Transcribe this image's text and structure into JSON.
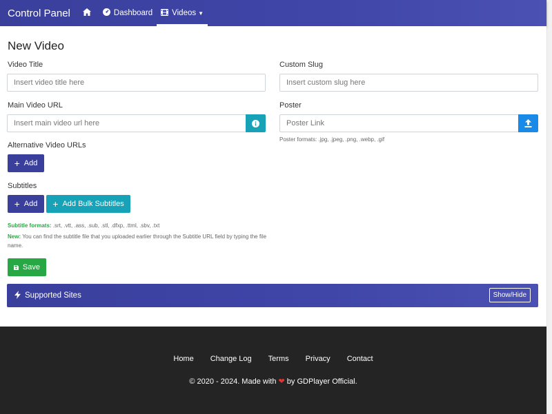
{
  "navbar": {
    "brand": "Control Panel",
    "items": [
      {
        "label": "",
        "icon": "home-icon"
      },
      {
        "label": "Dashboard",
        "icon": "dashboard-icon"
      },
      {
        "label": "Videos",
        "icon": "film-icon"
      }
    ]
  },
  "page": {
    "title": "New Video"
  },
  "form": {
    "video_title": {
      "label": "Video Title",
      "placeholder": "Insert video title here"
    },
    "custom_slug": {
      "label": "Custom Slug",
      "placeholder": "Insert custom slug here"
    },
    "main_url": {
      "label": "Main Video URL",
      "placeholder": "Insert main video url here"
    },
    "poster": {
      "label": "Poster",
      "placeholder": "Poster Link",
      "help": "Poster formats: .jpg, .jpeg, .png, .webp, .gif"
    },
    "alt_urls": {
      "label": "Alternative Video URLs",
      "add_label": "Add"
    },
    "subtitles": {
      "label": "Subtitles",
      "add_label": "Add",
      "bulk_label": "Add Bulk Subtitles",
      "formats_label": "Subtitle formats:",
      "formats": ".srt, .vtt, .ass, .sub, .stl, .dfxp, .ttml, .sbv, .txt",
      "new_label": "New:",
      "new_text": "You can find the subtitle file that you uploaded earlier through the Subtitle URL field by typing the file name."
    },
    "save_label": "Save"
  },
  "supported_sites": {
    "title": "Supported Sites",
    "toggle_label": "Show/Hide"
  },
  "footer": {
    "links": [
      "Home",
      "Change Log",
      "Terms",
      "Privacy",
      "Contact"
    ],
    "copyright_before": "© 2020 - 2024. Made with",
    "copyright_after": "by GDPlayer Official."
  },
  "colors": {
    "primary": "#3a3f9c",
    "info": "#17a2b8",
    "upload": "#1a8ae8",
    "success": "#28a745",
    "footer_bg": "#242424",
    "heart": "#e3342f"
  }
}
